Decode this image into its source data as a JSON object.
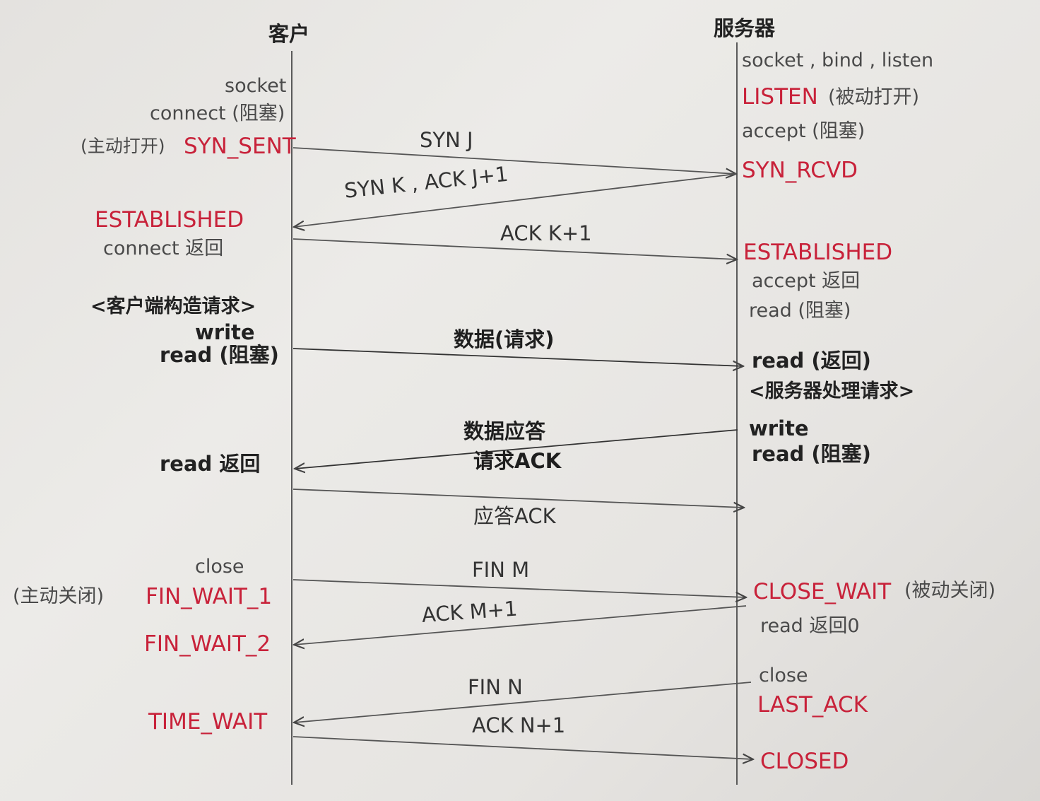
{
  "client": {
    "header": "客户",
    "socket": "socket",
    "connect_block": "connect (阻塞)",
    "active_open": "(主动打开)",
    "syn_sent": "SYN_SENT",
    "established": "ESTABLISHED",
    "connect_return": "connect 返回",
    "construct_request": "<客户端构造请求>",
    "write": "write",
    "read_block": "read (阻塞)",
    "read_return": "read 返回",
    "close": "close",
    "active_close": "(主动关闭)",
    "fin_wait_1": "FIN_WAIT_1",
    "fin_wait_2": "FIN_WAIT_2",
    "time_wait": "TIME_WAIT"
  },
  "server": {
    "header": "服务器",
    "socket_bind_listen": "socket , bind , listen",
    "listen": "LISTEN",
    "passive_open": "(被动打开)",
    "accept_block": "accept (阻塞)",
    "syn_rcvd": "SYN_RCVD",
    "established": "ESTABLISHED",
    "accept_return": "accept 返回",
    "read_block_1": "read (阻塞)",
    "read_return": "read (返回)",
    "process_request": "<服务器处理请求>",
    "write": "write",
    "read_block_2": "read (阻塞)",
    "close_wait": "CLOSE_WAIT",
    "passive_close": "(被动关闭)",
    "read_return_0": "read 返回0",
    "close": "close",
    "last_ack": "LAST_ACK",
    "closed": "CLOSED"
  },
  "messages": {
    "syn_j": "SYN J",
    "syn_k_ack": "SYN K , ACK J+1",
    "ack_k": "ACK K+1",
    "data_request": "数据(请求)",
    "data_reply": "数据应答",
    "request_ack": "请求ACK",
    "reply_ack": "应答ACK",
    "fin_m": "FIN M",
    "ack_m": "ACK M+1",
    "fin_n": "FIN N",
    "ack_n": "ACK N+1"
  },
  "colors": {
    "state_red": "#c8223a",
    "line_gray": "#555555"
  }
}
